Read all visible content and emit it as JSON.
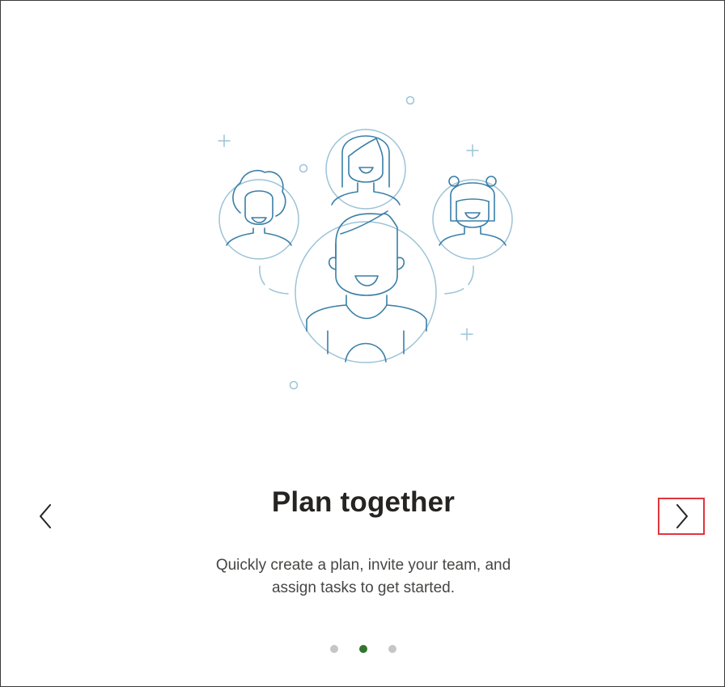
{
  "slide": {
    "title": "Plan together",
    "description": "Quickly create a plan, invite your team, and assign tasks to get started."
  },
  "navigation": {
    "prev_icon": "chevron-left-icon",
    "next_icon": "chevron-right-icon",
    "next_highlight_color": "#e0353d"
  },
  "pagination": {
    "total": 3,
    "current": 2,
    "active_color": "#31752f",
    "inactive_color": "#c8c6c4"
  },
  "illustration": {
    "icon": "team-people-icon",
    "stroke_color": "#3a7fa8",
    "circle_color": "#9cc3d8"
  }
}
